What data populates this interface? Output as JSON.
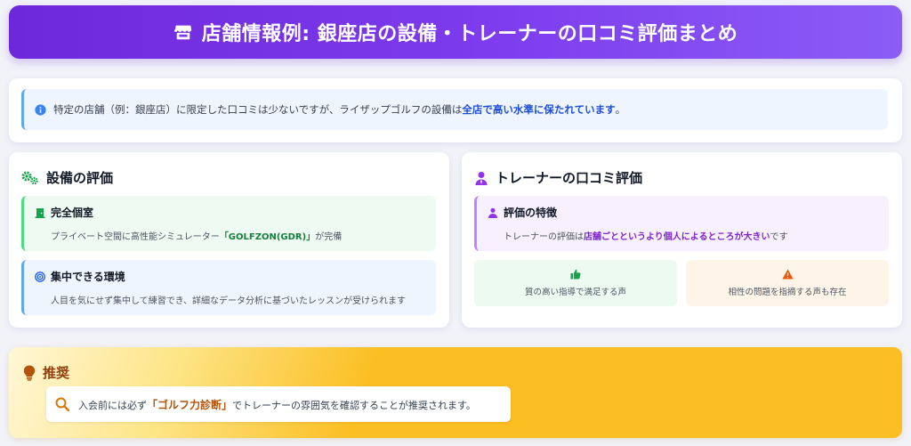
{
  "header": {
    "title": "店舗情報例: 銀座店の設備・トレーナーの口コミ評価まとめ",
    "icon": "store-icon"
  },
  "info": {
    "text_before": "特定の店舗（例：銀座店）に限定した口コミは少ないですが、ライザップゴルフの設備は",
    "highlight": "全店で高い水準に保たれています",
    "text_after": "。",
    "icon": "info-icon"
  },
  "facility": {
    "title": "設備の評価",
    "icon": "gears-icon",
    "items": [
      {
        "title": "完全個室",
        "icon": "door-icon",
        "text_before": "プライベート空間に高性能シミュレーター",
        "highlight": "「GOLFZON(GDR)」",
        "text_after": "が完備"
      },
      {
        "title": "集中できる環境",
        "icon": "target-icon",
        "text": "人目を気にせず集中して練習でき、詳細なデータ分析に基づいたレッスンが受けられます"
      }
    ]
  },
  "trainer": {
    "title": "トレーナーの口コミ評価",
    "icon": "user-tie-icon",
    "feature": {
      "title": "評価の特徴",
      "icon": "user-icon",
      "text_before": "トレーナーの評価は",
      "highlight": "店舗ごとというより個人によるところが大きい",
      "text_after": "です"
    },
    "positive": {
      "text": "質の高い指導で満足する声",
      "icon": "thumbs-up-icon"
    },
    "negative": {
      "text": "相性の問題を指摘する声も存在",
      "icon": "warning-icon"
    }
  },
  "recommendation": {
    "title": "推奨",
    "icon": "lightbulb-icon",
    "text_before": "入会前には必ず",
    "highlight": "「ゴルフ力診断」",
    "text_after": "でトレーナーの雰囲気を確認することが推奨されます。",
    "search_icon": "search-icon"
  },
  "colors": {
    "header_gradient_start": "#6d28d9",
    "header_gradient_end": "#8b5cf6",
    "info_accent": "#1d4ed8",
    "green_accent": "#15803d",
    "purple_accent": "#7e22ce",
    "recommendation_bg": "#fbbf24"
  }
}
